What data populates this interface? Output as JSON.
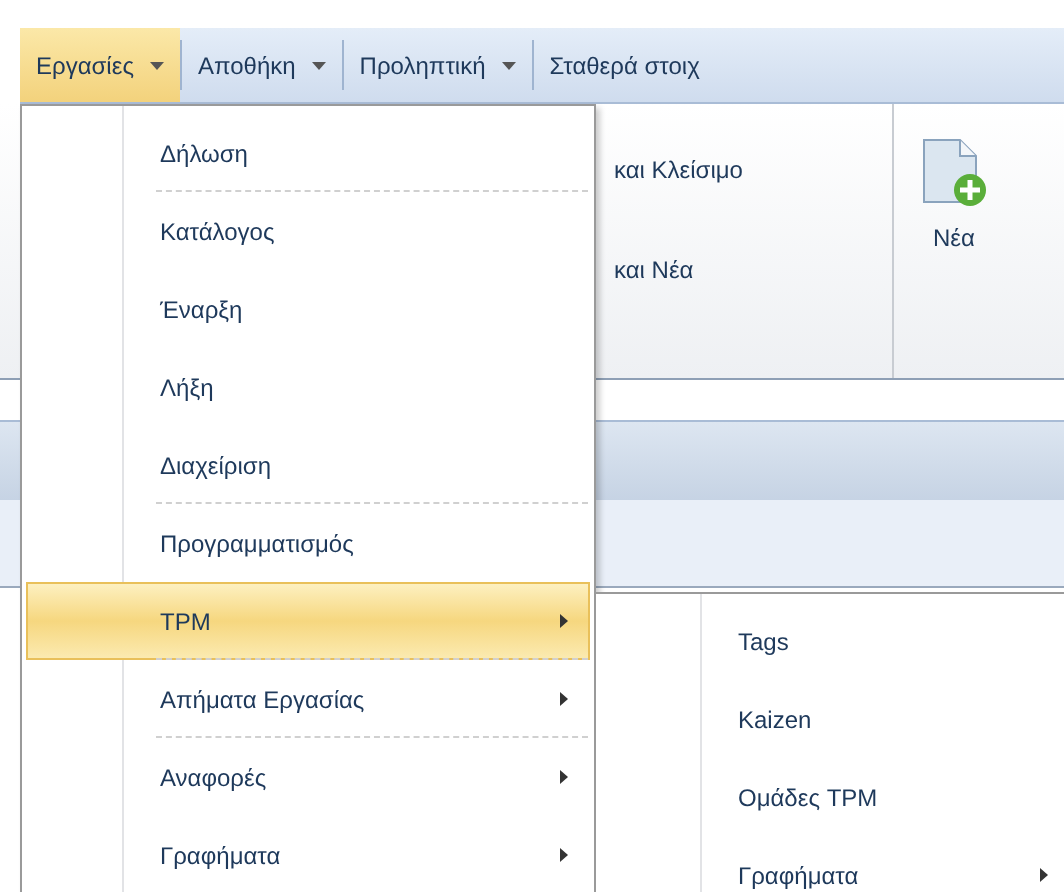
{
  "menu_bar": [
    {
      "label": "Εργασίες",
      "selected": true,
      "has_dropdown": true
    },
    {
      "label": "Αποθήκη",
      "selected": false,
      "has_dropdown": true
    },
    {
      "label": "Προληπτική",
      "selected": false,
      "has_dropdown": true
    },
    {
      "label": "Σταθερά στοιχ",
      "selected": false,
      "has_dropdown": false
    }
  ],
  "ribbon": {
    "buttons": [
      {
        "label": "και Κλείσιμο"
      },
      {
        "label": "και Νέα"
      }
    ],
    "new_button": {
      "label": "Νέα"
    }
  },
  "dropdown": {
    "items": [
      {
        "label": "Δήλωση",
        "selected": false,
        "has_submenu": false,
        "separator_after": true
      },
      {
        "label": "Κατάλογος",
        "selected": false,
        "has_submenu": false,
        "separator_after": false
      },
      {
        "label": "Έναρξη",
        "selected": false,
        "has_submenu": false,
        "separator_after": false
      },
      {
        "label": "Λήξη",
        "selected": false,
        "has_submenu": false,
        "separator_after": false
      },
      {
        "label": "Διαχείριση",
        "selected": false,
        "has_submenu": false,
        "separator_after": true
      },
      {
        "label": "Προγραμματισμός",
        "selected": false,
        "has_submenu": false,
        "separator_after": false
      },
      {
        "label": "TPM",
        "selected": true,
        "has_submenu": true,
        "separator_after": true
      },
      {
        "label": "Απήματα Εργασίας",
        "selected": false,
        "has_submenu": true,
        "separator_after": true
      },
      {
        "label": "Αναφορές",
        "selected": false,
        "has_submenu": true,
        "separator_after": false
      },
      {
        "label": "Γραφήματα",
        "selected": false,
        "has_submenu": true,
        "separator_after": false
      }
    ]
  },
  "submenu": {
    "items": [
      {
        "label": "Tags",
        "selected": false,
        "has_submenu": false
      },
      {
        "label": "Kaizen",
        "selected": false,
        "has_submenu": false
      },
      {
        "label": "Ομάδες TPM",
        "selected": false,
        "has_submenu": false
      },
      {
        "label": "Γραφήματα",
        "selected": false,
        "has_submenu": true
      }
    ]
  }
}
